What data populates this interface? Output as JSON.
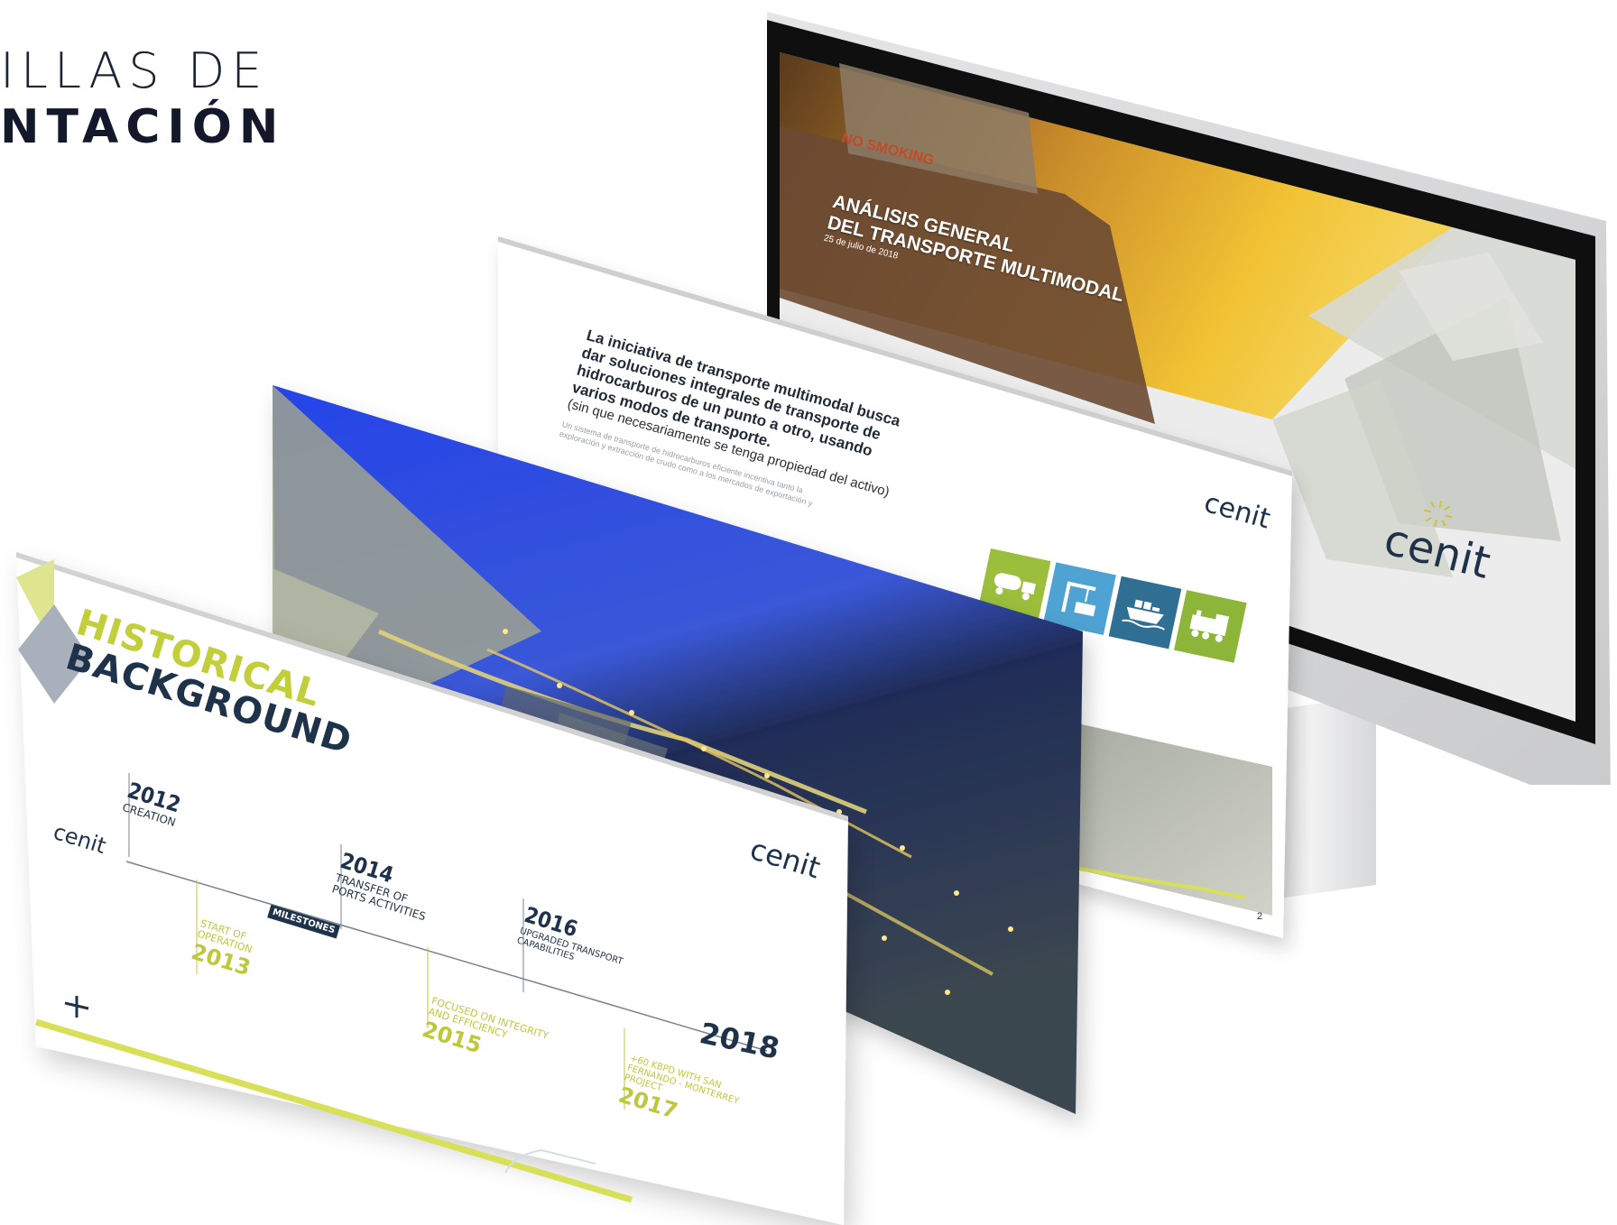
{
  "heading": {
    "line1": "ILLAS DE",
    "line2": "NTACIÓN"
  },
  "monitor_slide": {
    "title_line1": "ANÁLISIS GENERAL",
    "title_line2": "DEL TRANSPORTE MULTIMODAL",
    "date": "25 de julio de 2018",
    "ship_sign": "NO SMOKING",
    "logo": "cenit"
  },
  "text_slide": {
    "lead_lines": [
      "La iniciativa de transporte multimodal busca",
      "dar soluciones integrales de transporte de",
      "hidrocarburos de un punto a otro, usando",
      "varios modos de transporte."
    ],
    "sub": "(sin que necesariamente se tenga propiedad del activo)",
    "small_lines": [
      "Un sistema de transporte de hidrocarburos eficiente incentiva tanto la",
      "exploración y extracción de crudo como a los mercados de exportación y"
    ],
    "logo": "cenit",
    "page_number": "2",
    "tiles": [
      {
        "icon": "tanker-truck-icon",
        "color": "#9bbf3c"
      },
      {
        "icon": "port-crane-icon",
        "color": "#4ea3d3"
      },
      {
        "icon": "cargo-ship-icon",
        "color": "#2f6f93"
      },
      {
        "icon": "train-icon",
        "color": "#8cb53a"
      }
    ]
  },
  "history_slide": {
    "title_line1": "HISTORICAL",
    "title_line2": "BACKGROUND",
    "milestones_badge": "MILESTONES",
    "logo": "cenit",
    "events_top": [
      {
        "year": "2012",
        "label": "CREATION"
      },
      {
        "year": "2014",
        "label": "TRANSFER OF\nPORTS ACTIVITIES"
      },
      {
        "year": "2016",
        "label": "UPGRADED TRANSPORT\nCAPABILITIES"
      }
    ],
    "events_bottom": [
      {
        "year": "2013",
        "label": "START OF\nOPERATION"
      },
      {
        "year": "2015",
        "label": "FOCUSED ON INTEGRITY\nAND EFFICIENCY"
      },
      {
        "year": "2017",
        "label": "+60 KBPD WITH SAN\nFERNANDO - MONTERREY\nPROJECT"
      }
    ],
    "final_year": "2018"
  }
}
